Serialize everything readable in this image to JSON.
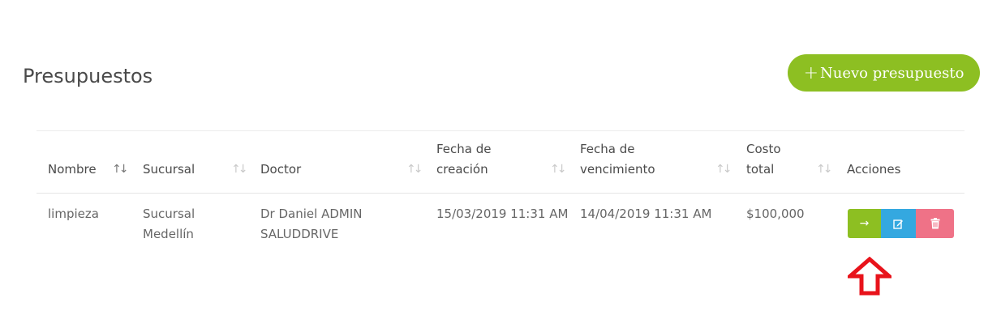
{
  "header": {
    "title": "Presupuestos",
    "new_button_plus": "+",
    "new_button_label": "Nuevo presupuesto"
  },
  "table": {
    "columns": [
      {
        "label": "Nombre",
        "sort": "active"
      },
      {
        "label": "Sucursal",
        "sort": "inactive"
      },
      {
        "label": "Doctor",
        "sort": "inactive"
      },
      {
        "label": "Fecha de creación",
        "sort": "inactive"
      },
      {
        "label": "Fecha de vencimiento",
        "sort": "inactive"
      },
      {
        "label": "Costo total",
        "sort": "inactive"
      },
      {
        "label": "Acciones",
        "sort": "none"
      }
    ],
    "rows": [
      {
        "nombre": "limpieza",
        "sucursal": "Sucursal Medellín",
        "doctor": "Dr Daniel ADMIN SALUDDRIVE",
        "fecha_creacion": "15/03/2019 11:31 AM",
        "fecha_vencimiento": "14/04/2019 11:31 AM",
        "costo_total": "$100,000"
      }
    ],
    "sort_glyph": "↑↓",
    "actions": {
      "go_icon": "→",
      "edit_icon": "edit-icon",
      "delete_icon": "trash-icon"
    }
  },
  "colors": {
    "brand_green": "#8dbf22",
    "edit_blue": "#34a8e0",
    "delete_pink": "#ef7287",
    "annotation_red": "#e8131b"
  }
}
